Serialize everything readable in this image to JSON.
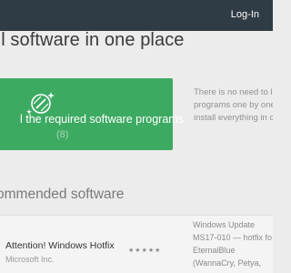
{
  "header": {
    "login_label": "Log-In"
  },
  "hero": {
    "headline": "ul software in one place"
  },
  "install": {
    "label": "l the required software programs",
    "count": "(8)",
    "icon": "sparkle-link-icon"
  },
  "side_text": {
    "lines": [
      "There is no need to lo",
      "programs one by one",
      "install everything in c"
    ]
  },
  "recommended": {
    "title": "ommended software",
    "app": {
      "name": "Attention! Windows Hotfix",
      "vendor": "Microsoft Inc.",
      "rating": 5,
      "description_lines": [
        "Windows Update",
        "MS17-010 — hotfix fo",
        "EternalBlue",
        "(WannaCry, Petya,"
      ]
    }
  },
  "colors": {
    "topbar": "#2f3c46",
    "accent_green": "#3daa62",
    "background": "#ececec"
  }
}
